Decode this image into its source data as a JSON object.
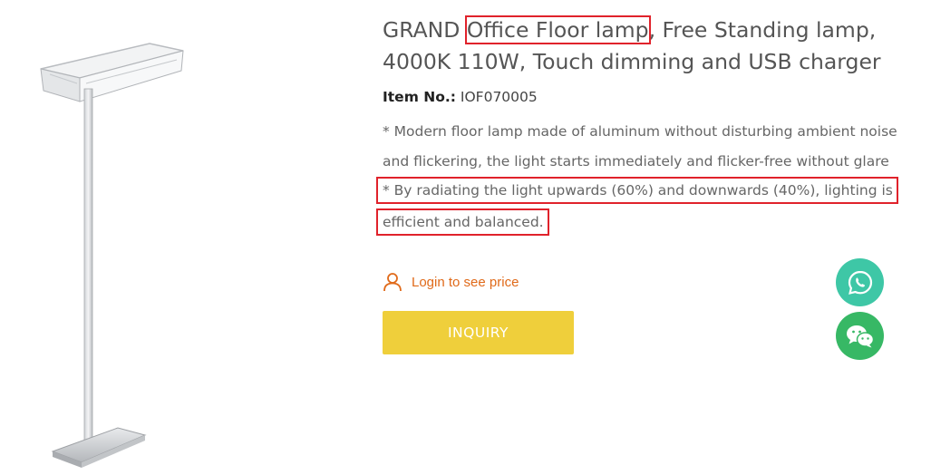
{
  "product": {
    "title_prefix": "GRAND ",
    "title_highlight": "Office Floor lamp",
    "title_rest": ", Free Standing lamp, 4000K 110W, Touch dimming and USB charger",
    "item_label": "Item No.:",
    "item_value": "IOF070005",
    "desc_1": "* Modern floor lamp made of aluminum without disturbing ambient noise and flickering, the light starts immediately and flicker-free without glare",
    "desc_2_line1": "* By radiating the light upwards (60%) and downwards (40%), lighting is",
    "desc_2_line2": "efficient and balanced."
  },
  "actions": {
    "login_text": "Login to see price",
    "inquiry_label": "INQUIRY"
  },
  "icons": {
    "login": "user-icon",
    "whatsapp": "whatsapp-icon",
    "wechat": "wechat-icon"
  },
  "colors": {
    "highlight_border": "#e0222b",
    "inquiry_bg": "#efcf3b",
    "login_text": "#e06a1a",
    "whatsapp_bg": "#3ec7a6",
    "wechat_bg": "#37b865"
  }
}
